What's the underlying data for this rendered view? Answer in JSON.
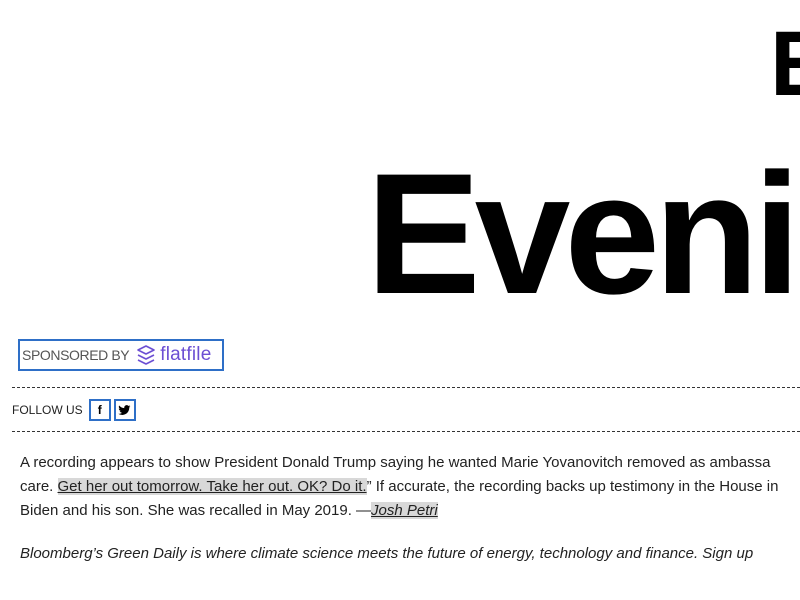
{
  "hero": {
    "line1": "E",
    "line2": "Eveni"
  },
  "sponsor": {
    "label": "SPONSORED BY",
    "brand": "flatfile",
    "brand_color": "#6c4fd3",
    "border_color": "#2e6fc7"
  },
  "follow": {
    "label": "FOLLOW US",
    "facebook_glyph": "f",
    "twitter_icon": "twitter-bird-icon"
  },
  "article": {
    "line1": "A recording appears to show President Donald Trump saying he wanted Marie Yovanovitch removed as ambassa",
    "line2_prefix": "care. ",
    "quote": "Get her out tomorrow. Take her out. OK? Do it.",
    "line2_suffix": "” If accurate, the recording backs up testimony in the House in",
    "line3_prefix": "Biden and his son. She was recalled in May 2019. —",
    "author": "Josh Petri"
  },
  "promo": {
    "text": "Bloomberg’s Green Daily is where climate science meets the future of energy, technology and finance. Sign up"
  }
}
